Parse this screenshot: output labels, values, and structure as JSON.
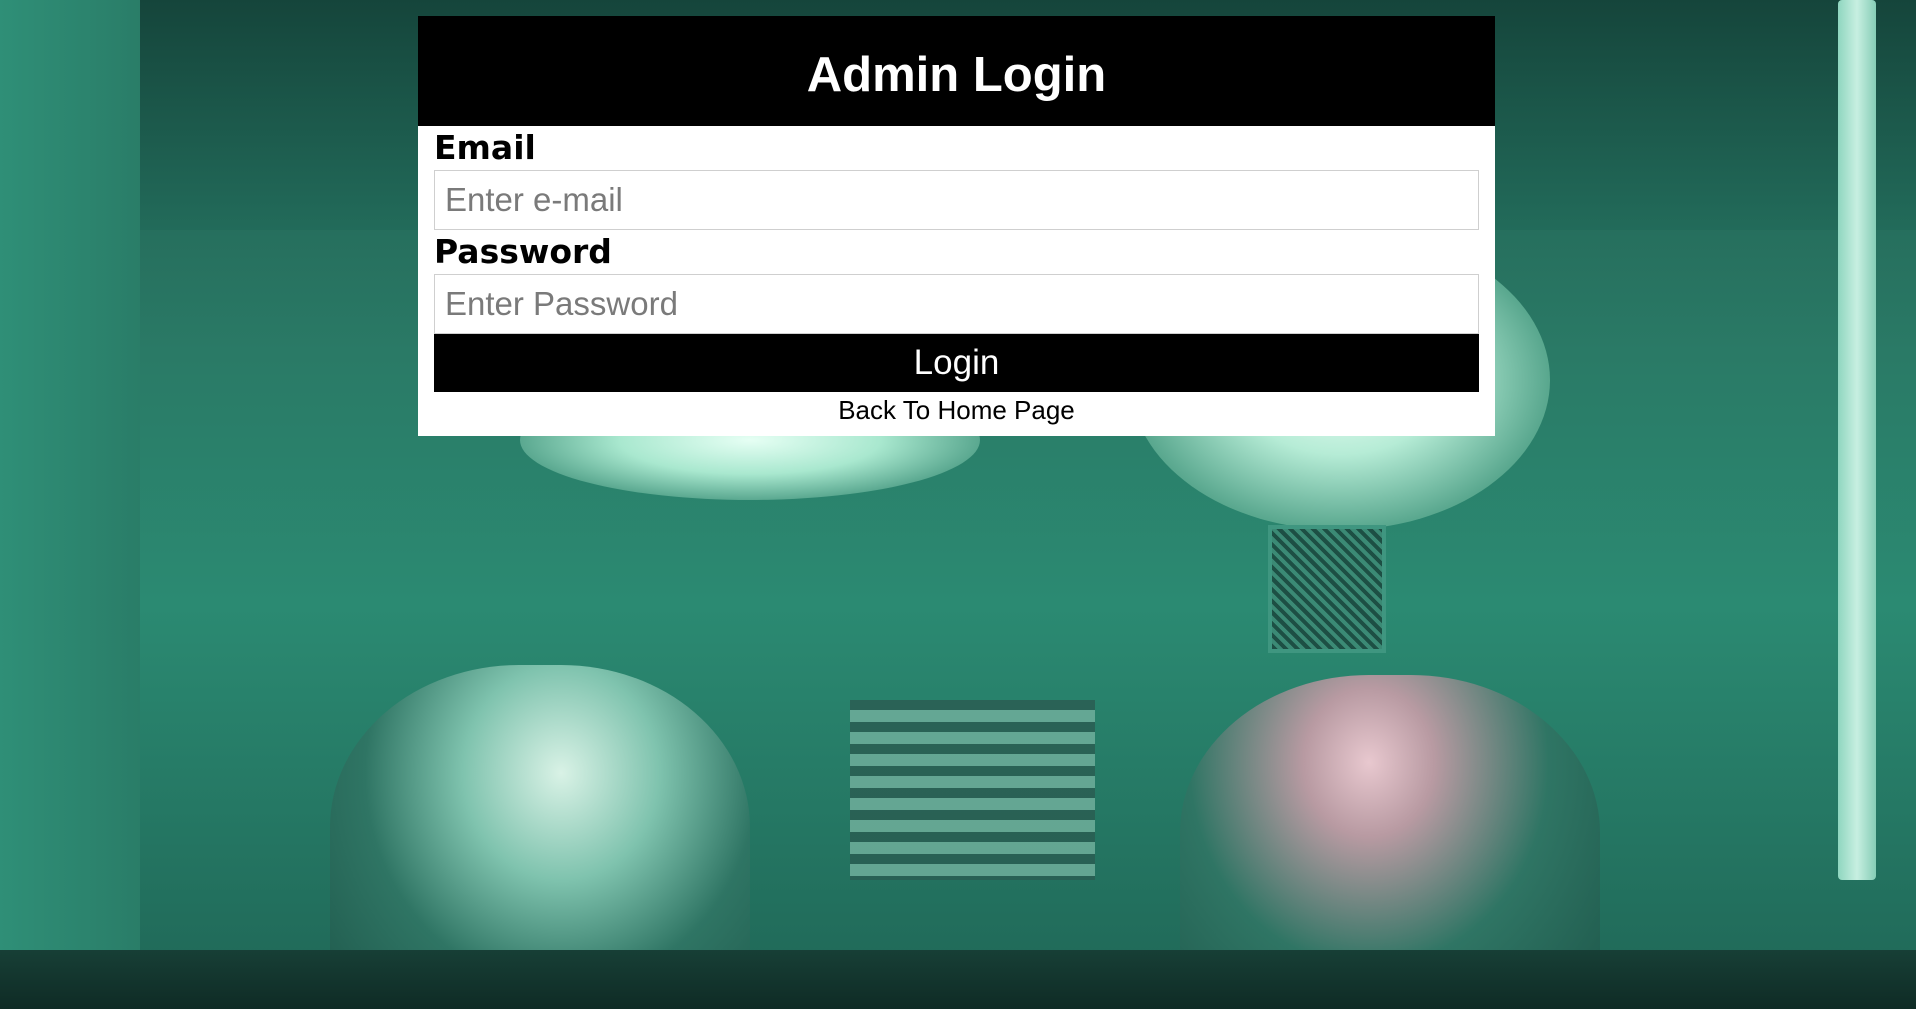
{
  "page": {
    "title": "Admin Login"
  },
  "form": {
    "email_label": "Email",
    "email_placeholder": "Enter e-mail",
    "email_value": "",
    "password_label": "Password",
    "password_placeholder": "Enter Password",
    "password_value": "",
    "login_label": "Login",
    "back_link_label": "Back To Home Page"
  },
  "colors": {
    "header_bg": "#000000",
    "card_bg": "#ffffff",
    "button_bg": "#000000",
    "background_tint": "#2a7a66"
  }
}
